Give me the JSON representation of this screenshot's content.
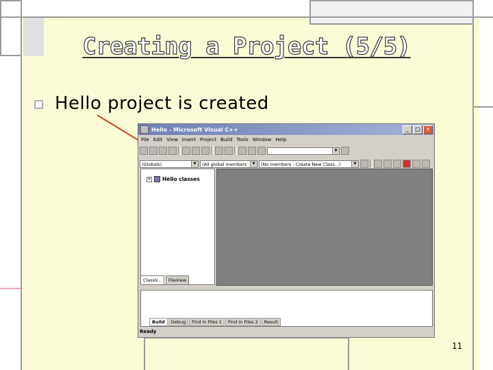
{
  "slide": {
    "title": "Creating a Project (5/5)",
    "bullet": "Hello project is created",
    "page_number": "11"
  },
  "window": {
    "title": "Hello - Microsoft Visual C++",
    "controls": [
      "_",
      "□",
      "×"
    ],
    "menu": [
      "File",
      "Edit",
      "View",
      "Insert",
      "Project",
      "Build",
      "Tools",
      "Window",
      "Help"
    ],
    "combo_globals": "(Globals)",
    "combo_members": "(All global members",
    "combo_class": "(No members - Create New Class...)",
    "tree_label": "Hello classes",
    "tree_expand": "+",
    "workspace_tabs": [
      "ClassV...",
      "FileView"
    ],
    "output_tabs": [
      "Build",
      "Debug",
      "Find in Files 1",
      "Find in Files 2",
      "Result"
    ],
    "status": "Ready"
  },
  "colors": {
    "slide_background": "#fbfbd6",
    "arrow": "#cc4422",
    "editor_background": "#808080"
  }
}
